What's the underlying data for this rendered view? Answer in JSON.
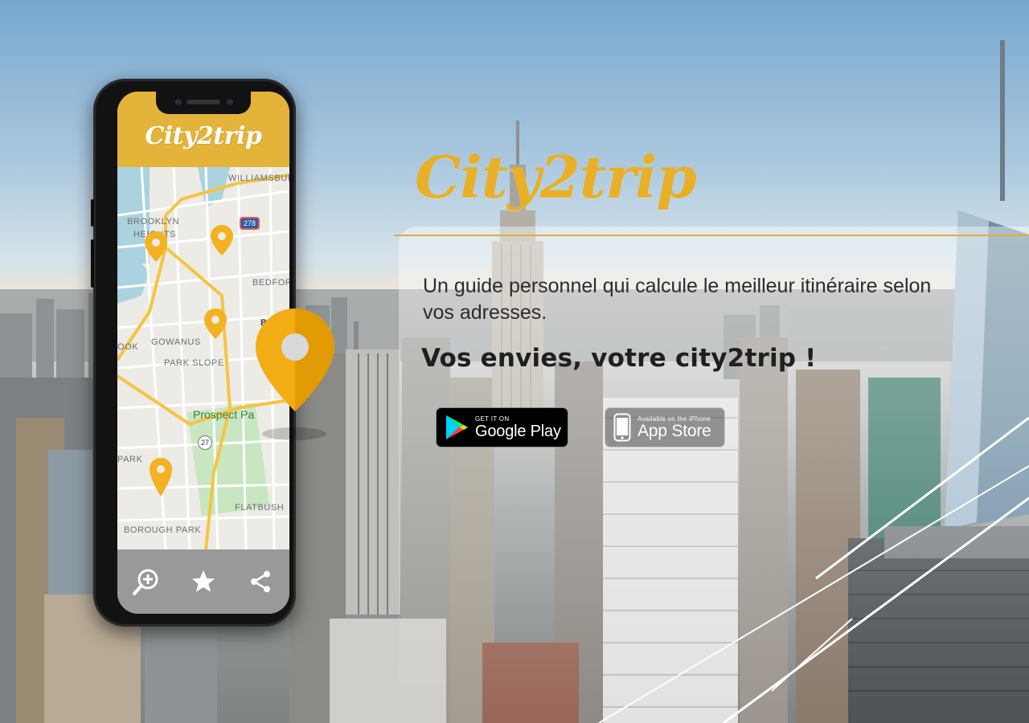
{
  "brand": {
    "title": "City2trip",
    "accent_color": "#e8af28"
  },
  "hero": {
    "description": "Un guide personnel qui calcule le meilleur itinéraire selon vos adresses.",
    "tagline": "Vos envies, votre city2trip !"
  },
  "stores": {
    "google_play": {
      "small": "GET IT ON",
      "big": "Google Play",
      "icon": "google-play-icon"
    },
    "app_store": {
      "small": "Available on the iPhone",
      "big": "App Store",
      "icon": "iphone-icon"
    }
  },
  "phone": {
    "app_title": "City2trip",
    "header_color": "#e3b33a",
    "map_labels": {
      "williamsburg": "WILLIAMSBUR",
      "brooklyn_heights_1": "BROOKLYN",
      "brooklyn_heights_2": "HEIGHTS",
      "bedford": "BEDFORD",
      "bk": "BR",
      "ook": "OOK",
      "gowanus": "GOWANUS",
      "park_slope": "PARK SLOPE",
      "prospect_park": "Prospect Pa",
      "park": "PARK",
      "flatbush": "FLATBUSH",
      "borough_park": "BOROUGH PARK",
      "highway_278": "278",
      "route_27": "27"
    },
    "toolbar": [
      {
        "name": "zoom-in-icon"
      },
      {
        "name": "star-icon"
      },
      {
        "name": "share-icon"
      }
    ]
  }
}
